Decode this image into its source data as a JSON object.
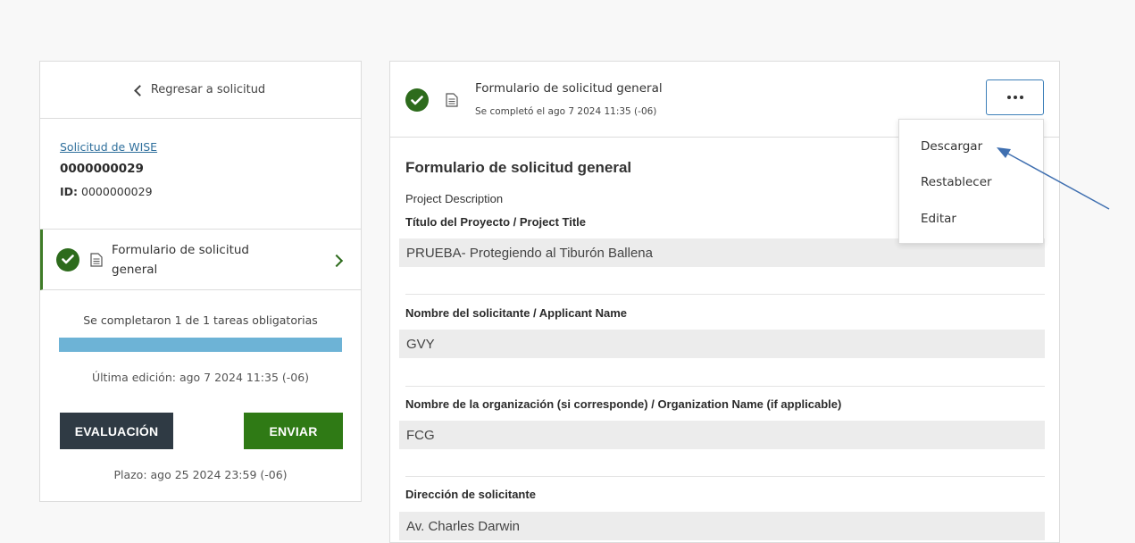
{
  "sidebar": {
    "back_label": "Regresar a solicitud",
    "app_link": "Solicitud de WISE",
    "app_number": "0000000029",
    "id_label": "ID:",
    "id_value": "0000000029",
    "task_label": "Formulario de solicitud general",
    "progress_text": "Se completaron 1 de 1 tareas obligatorias",
    "progress": 1.0,
    "last_edit": "Última edición: ago 7 2024 11:35 (-06)",
    "eval_button": "EVALUACIÓN",
    "send_button": "ENVIAR",
    "deadline": "Plazo: ago 25 2024 23:59 (-06)"
  },
  "form_header": {
    "title": "Formulario de solicitud general",
    "completed": "Se completó el ago 7 2024 11:35 (-06)"
  },
  "menu": {
    "items": [
      "Descargar",
      "Restablecer",
      "Editar"
    ]
  },
  "form": {
    "title": "Formulario de solicitud general",
    "section": "Project Description",
    "fields": [
      {
        "label": "Título del Proyecto / Project Title",
        "value": "PRUEBA- Protegiendo al Tiburón Ballena"
      },
      {
        "label": "Nombre del solicitante / Applicant Name",
        "value": "GVY"
      },
      {
        "label": "Nombre de la organización (si corresponde) / Organization Name (if applicable)",
        "value": "FCG"
      },
      {
        "label": "Dirección de solicitante",
        "value": "Av. Charles Darwin"
      }
    ]
  },
  "colors": {
    "accent_green": "#2d6b1c",
    "send_green": "#2f7a15",
    "eval_dark": "#2f3a44",
    "progress_blue": "#6db3d6",
    "annotation_arrow": "#3f6fb0"
  },
  "icons": [
    "chevron-left-icon",
    "check-circle-icon",
    "document-icon",
    "chevron-right-icon",
    "more-options-icon",
    "annotation-arrow"
  ]
}
